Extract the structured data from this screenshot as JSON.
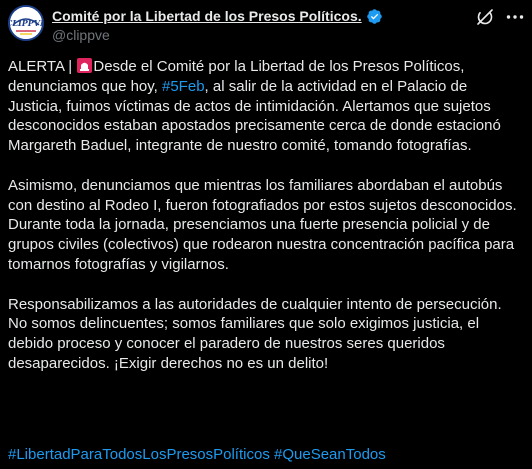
{
  "author": {
    "display_name": "Comité por la Libertad de los Presos Políticos.",
    "handle": "@clippve",
    "avatar_text": "CLIPPVE",
    "verified_icon": "verified-badge-icon"
  },
  "actions": {
    "grok_icon": "grok-icon",
    "more_icon": "more-icon"
  },
  "post": {
    "p1_prefix": "ALERTA | ",
    "p1_emoji": "siren-emoji",
    "p1_mid": "Desde el Comité por la Libertad de los Presos Políticos, denunciamos que hoy, ",
    "p1_hashtag": "#5Feb",
    "p1_suffix": ", al salir de la actividad en el Palacio de Justicia, fuimos víctimas de actos de intimidación. Alertamos que sujetos desconocidos estaban apostados precisamente cerca de donde estacionó Margareth Baduel, integrante de nuestro comité, tomando fotografías.",
    "p2": "Asimismo, denunciamos que mientras los familiares abordaban el autobús con destino al Rodeo I, fueron fotografiados por estos sujetos desconocidos. Durante toda la jornada, presenciamos una fuerte presencia policial y de grupos civiles (colectivos) que rodearon nuestra concentración pacífica para tomarnos fotografías y vigilarnos.",
    "p3": "Responsabilizamos a las autoridades de cualquier intento de persecución. No somos delincuentes; somos familiares que solo exigimos justicia, el debido proceso y conocer el paradero de nuestros seres queridos desaparecidos. ¡Exigir derechos no es un delito!",
    "hashtag_1": "#LibertadParaTodosLosPresosPolíticos",
    "hashtag_2": "#QueSeanTodos"
  },
  "colors": {
    "background": "#000000",
    "text": "#e7e9ea",
    "secondary": "#71767b",
    "link": "#1d9bf0",
    "verified": "#1d9bf0"
  }
}
